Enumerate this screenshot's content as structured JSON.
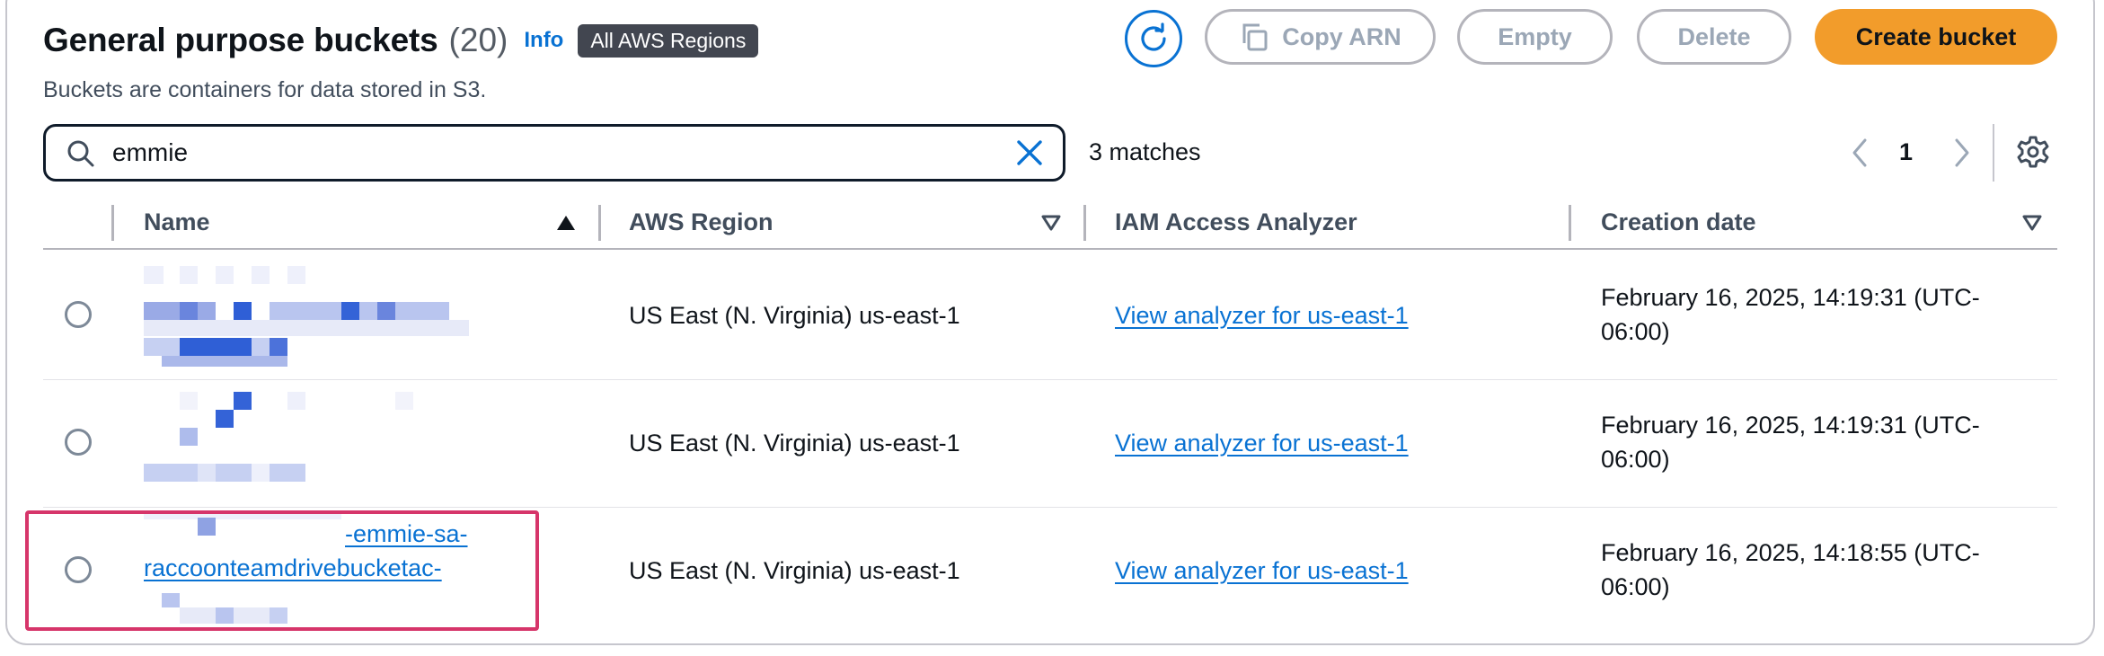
{
  "header": {
    "title": "General purpose buckets",
    "count": "(20)",
    "info": "Info",
    "region_badge": "All AWS Regions",
    "subtitle": "Buckets are containers for data stored in S3."
  },
  "toolbar": {
    "refresh_icon": "refresh-icon",
    "copy_arn": "Copy ARN",
    "empty": "Empty",
    "delete": "Delete",
    "create_bucket": "Create bucket"
  },
  "search": {
    "value": "emmie",
    "matches": "3 matches"
  },
  "pagination": {
    "current_page": "1"
  },
  "table": {
    "columns": {
      "name": "Name",
      "region": "AWS Region",
      "iam": "IAM Access Analyzer",
      "created": "Creation date"
    },
    "rows": [
      {
        "name": "",
        "region": "US East (N. Virginia) us-east-1",
        "analyzer": "View analyzer for us-east-1",
        "created_line1": "February 16, 2025, 14:19:31 (UTC-",
        "created_line2": "06:00)"
      },
      {
        "name": "",
        "region": "US East (N. Virginia) us-east-1",
        "analyzer": "View analyzer for us-east-1",
        "created_line1": "February 16, 2025, 14:19:31 (UTC-",
        "created_line2": "06:00)"
      },
      {
        "name_line1": "-emmie-sa-",
        "name_line2": "raccoonteamdrivebucketac-",
        "region": "US East (N. Virginia) us-east-1",
        "analyzer": "View analyzer for us-east-1",
        "created_line1": "February 16, 2025, 14:18:55 (UTC-",
        "created_line2": "06:00)"
      }
    ]
  },
  "colors": {
    "accent": "#0972d3",
    "primary_button": "#f29c2b",
    "highlight": "#d6356a"
  }
}
